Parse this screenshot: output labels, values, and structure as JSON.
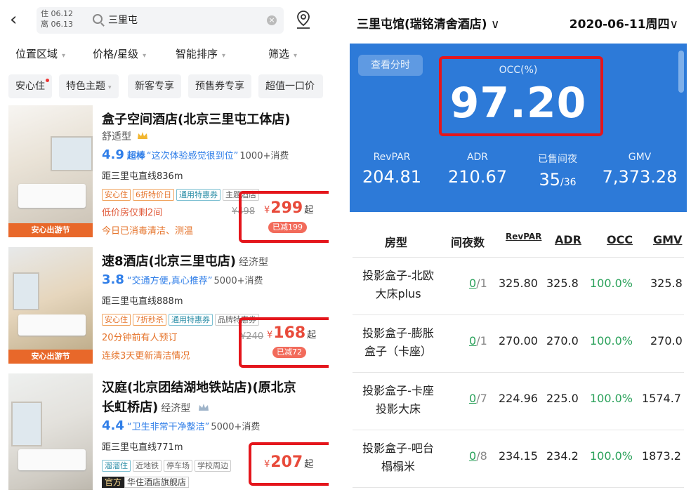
{
  "left": {
    "dates": {
      "checkin": "住 06.12",
      "checkout": "离 06.13"
    },
    "search": {
      "value": "三里屯"
    },
    "filters": [
      "位置区域",
      "价格/星级",
      "智能排序",
      "筛选"
    ],
    "tags": [
      "安心住",
      "特色主题",
      "新客专享",
      "预售券专享",
      "超值一口价"
    ],
    "hotels": [
      {
        "name": "盒子空间酒店(北京三里屯工体店)",
        "type": "舒适型",
        "score": "4.9",
        "level": "超棒",
        "quote": "“这次体验感觉很到位”",
        "consume": "1000+消费",
        "distance": "距三里屯直线836m",
        "badges": [
          "安心住",
          "6折特价日",
          "通用特惠券",
          "主题酒店"
        ],
        "line1": "低价房仅剩2间",
        "line2": "今日已消毒清洁、测温",
        "old_price": "¥498",
        "price": "299",
        "reduce": "已减199",
        "banner": "安心出游节"
      },
      {
        "name": "速8酒店(北京三里屯店)",
        "type": "经济型",
        "score": "3.8",
        "level": "",
        "quote": "“交通方便,真心推荐”",
        "consume": "5000+消费",
        "distance": "距三里屯直线888m",
        "badges": [
          "安心住",
          "7折秒杀",
          "通用特惠券",
          "品牌特惠券"
        ],
        "line1": "20分钟前有人预订",
        "line2": "连续3天更新清洁情况",
        "old_price": "¥240",
        "price": "168",
        "reduce": "已减72",
        "banner": "安心出游节"
      },
      {
        "name_line1": "汉庭(北京团结湖地铁站店)(原北京",
        "name_line2": "长虹桥店)",
        "type": "经济型",
        "score": "4.4",
        "quote": "“卫生非常干净整洁”",
        "consume": "5000+消费",
        "distance": "距三里屯直线771m",
        "badges": [
          "溜溜住",
          "近地铁",
          "停车场",
          "学校周边"
        ],
        "official": "官方",
        "official_store": "华住酒店旗舰店",
        "price": "207"
      }
    ],
    "yen": "¥",
    "qi": "起"
  },
  "right": {
    "hotel": "三里屯馆(瑞铭清舍酒店)",
    "date": "2020-06-11周四",
    "time_button": "查看分时",
    "occ_label": "OCC(%)",
    "occ_value": "97.20",
    "metrics": [
      {
        "label": "RevPAR",
        "value": "204.81"
      },
      {
        "label": "ADR",
        "value": "210.67"
      },
      {
        "label": "已售间夜",
        "value": "35",
        "sub": "/36"
      },
      {
        "label": "GMV",
        "value": "7,373.28"
      }
    ],
    "table": {
      "headers": [
        "房型",
        "间夜数",
        "RevPAR",
        "ADR",
        "OCC",
        "GMV"
      ],
      "rows": [
        {
          "type1": "投影盒子-北欧",
          "type2": "大床plus",
          "n": "0",
          "d": "/1",
          "revpar": "325.80",
          "adr": "325.8",
          "occ": "100.0%",
          "gmv": "325.8"
        },
        {
          "type1": "投影盒子-膨胀",
          "type2": "盒子（卡座）",
          "n": "0",
          "d": "/1",
          "revpar": "270.00",
          "adr": "270.0",
          "occ": "100.0%",
          "gmv": "270.0"
        },
        {
          "type1": "投影盒子-卡座",
          "type2": "投影大床",
          "n": "0",
          "d": "/7",
          "revpar": "224.96",
          "adr": "225.0",
          "occ": "100.0%",
          "gmv": "1574.7"
        },
        {
          "type1": "投影盒子-吧台",
          "type2": "榻榻米",
          "n": "0",
          "d": "/8",
          "revpar": "234.15",
          "adr": "234.2",
          "occ": "100.0%",
          "gmv": "1873.2"
        }
      ]
    }
  }
}
